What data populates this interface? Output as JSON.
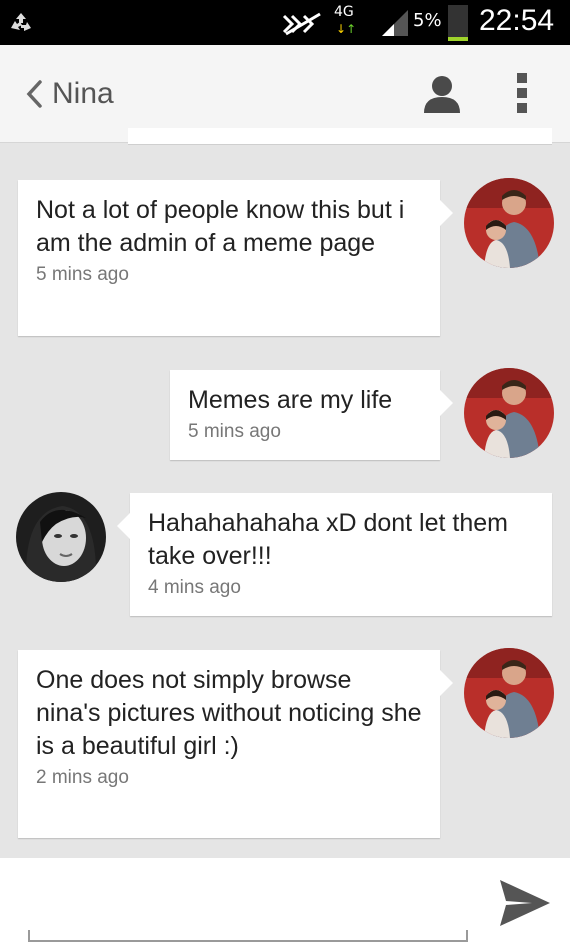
{
  "status_bar": {
    "network": "4G",
    "battery_text": "5%",
    "battery_level": 0.05,
    "time": "22:54",
    "colors": {
      "battery_fill": "#9fd32b"
    }
  },
  "header": {
    "contact_name": "Nina",
    "icons": [
      "chevron-left-icon",
      "person-icon",
      "overflow-menu-icon"
    ]
  },
  "messages": [
    {
      "side": "right",
      "text": "Not a lot of people know this but i am the admin of a meme page",
      "time": "5 mins ago"
    },
    {
      "side": "right",
      "text": "Memes are my life",
      "time": "5 mins ago"
    },
    {
      "side": "left",
      "text": "Hahahahahaha xD dont let them take over!!!",
      "time": "4 mins ago"
    },
    {
      "side": "right",
      "text": "One does not simply browse nina's pictures without noticing she is a beautiful girl :)",
      "time": "2 mins ago"
    }
  ],
  "composer": {
    "value": "",
    "placeholder": "",
    "send_icon": "send-icon"
  }
}
